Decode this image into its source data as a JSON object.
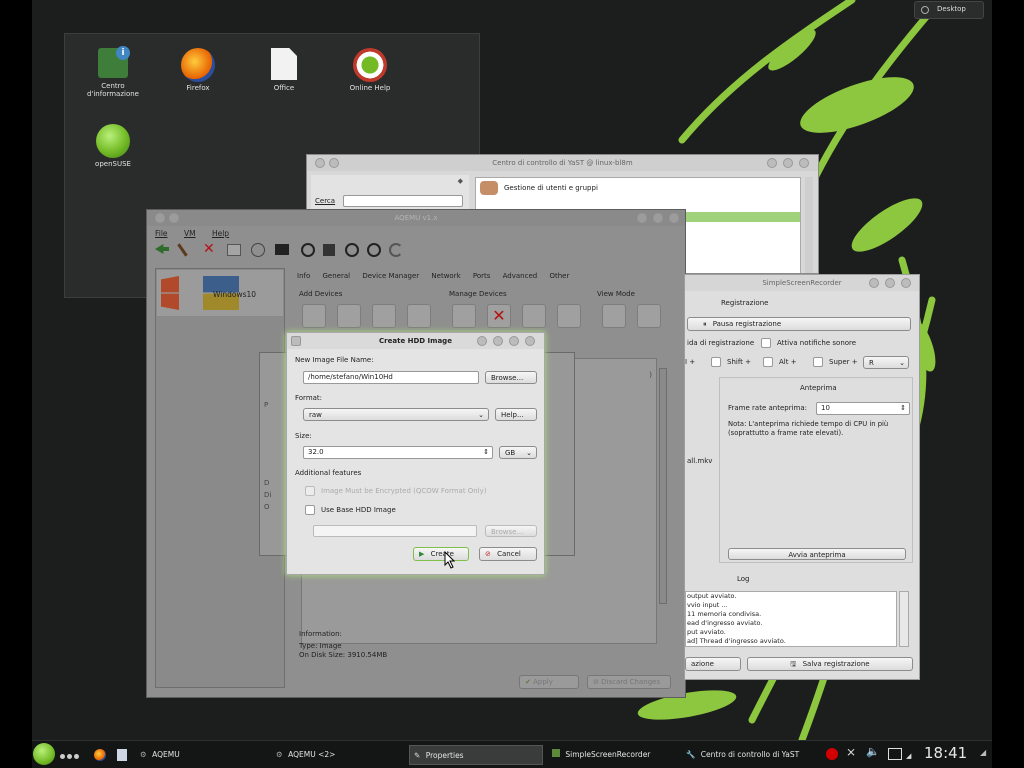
{
  "desktop_button": "Desktop",
  "folder_icons": [
    {
      "name": "info-center-icon",
      "label": "Centro\nd'informazione",
      "color": "#3f86c3"
    },
    {
      "name": "firefox-icon",
      "label": "Firefox",
      "color": "#e66000"
    },
    {
      "name": "office-icon",
      "label": "Office",
      "color": "#e8e8e8"
    },
    {
      "name": "online-help-icon",
      "label": "Online Help",
      "color": "#c0392b"
    },
    {
      "name": "opensuse-icon",
      "label": "openSUSE",
      "color": "#73ba25"
    }
  ],
  "yast": {
    "title": "Centro di controllo di YaST @ linux-bl8m",
    "search_label": "Cerca",
    "category": "Gestione di utenti e gruppi"
  },
  "aqemu": {
    "title": "AQEMU v1.x",
    "menu": [
      "File",
      "VM",
      "Help"
    ],
    "vm_name": "Windows10",
    "tabs": [
      "Info",
      "General",
      "Device Manager",
      "Network",
      "Ports",
      "Advanced",
      "Other"
    ],
    "sections": {
      "add": "Add Devices",
      "manage": "Manage Devices",
      "view": "View Mode"
    },
    "info_label": "Information:",
    "info_type": "Type: Image",
    "info_size": "On Disk Size: 3910.54MB",
    "apply_button": "Apply",
    "discard_button": "Discard Changes",
    "behind_text": [
      "P",
      "D",
      "Di",
      "O"
    ]
  },
  "dialog": {
    "title": "Create HDD Image",
    "file_label": "New Image File Name:",
    "file_value": "/home/stefano/Win10Hd",
    "browse_label": "Browse...",
    "format_label": "Format:",
    "format_value": "raw",
    "help_label": "Help...",
    "size_label": "Size:",
    "size_value": "32.0",
    "size_unit": "GB",
    "features_label": "Additional features",
    "encrypt_label": "Image Must be Encrypted (QCOW Format Only)",
    "base_label": "Use Base HDD Image",
    "browse2_label": "Browse...",
    "create_label": "Create",
    "cancel_label": "Cancel"
  },
  "ssr": {
    "title": "SimpleScreenRecorder",
    "section_recording": "Registrazione",
    "pause_button": "Pausa registrazione",
    "start_label": "ida di registrazione",
    "notify_label": "Attiva notifiche sonore",
    "hotkey_shift": "Shift +",
    "hotkey_alt": "Alt +",
    "hotkey_super": "Super +",
    "hotkey_key": "R",
    "hotkey_plus": "I +",
    "preview_section": "Anteprima",
    "frame_rate_label": "Frame rate anteprima:",
    "frame_rate_value": "10",
    "note": "Nota: L'anteprima richiede tempo di CPU in più (soprattutto a frame rate elevati).",
    "file_fragment": "all.mkv",
    "start_preview_button": "Avvia anteprima",
    "log_section": "Log",
    "log_lines": [
      "output avviato.",
      "vvio input ...",
      "11 memoria condivisa.",
      "ead d'ingresso avviato.",
      "put avviato.",
      "ad] Thread d'ingresso avviato."
    ],
    "cancel_fragment": "azione",
    "save_button": "Salva registrazione"
  },
  "taskbar": {
    "tasks": [
      {
        "name": "taskbar-aqemu",
        "label": "AQEMU"
      },
      {
        "name": "taskbar-aqemu-2",
        "label": "AQEMU <2>"
      },
      {
        "name": "taskbar-properties",
        "label": "Properties"
      },
      {
        "name": "taskbar-ssr",
        "label": "SimpleScreenRecorder"
      },
      {
        "name": "taskbar-yast",
        "label": "Centro di controllo di YaST"
      }
    ],
    "clock": "18:41"
  },
  "colors": {
    "accent_green": "#8dc63f",
    "taskbar_bg": "#141515",
    "desktop_bg": "#1c1e1d"
  }
}
